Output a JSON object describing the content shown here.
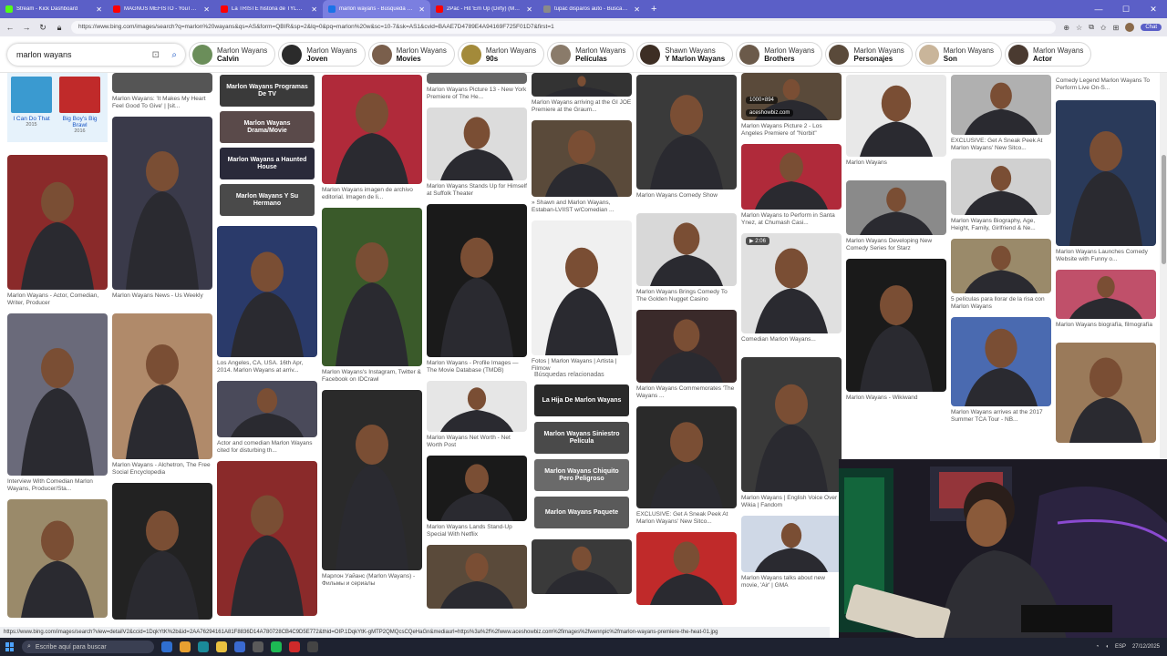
{
  "browser": {
    "tabs": [
      {
        "label": "Stream - Kick Dashboard",
        "color": "#53fc18"
      },
      {
        "label": "MAGNUS MEFISTO - YouTube",
        "color": "#ff0000"
      },
      {
        "label": "La TRISTE historia de TYLOR CHA",
        "color": "#ff0000"
      },
      {
        "label": "marlon wayans - Búsqueda Imáge",
        "color": "#1a73e8",
        "active": true
      },
      {
        "label": "2Pac - Hit 'Em Up (Dirty) (Music V",
        "color": "#ff0000"
      },
      {
        "label": "tupac disparos auto - Buscar con",
        "color": "#8a8a8a"
      }
    ],
    "new_tab": "+",
    "url": "https://www.bing.com/images/search?q=marlon%20wayans&qs=AS&form=QBIR&sp=2&lq=0&pq=marlon%20w&sc=10-7&sk=AS1&cvid=BAAE7D4789E4A94169F725F01D7&first=1",
    "chat_label": "Chat"
  },
  "search": {
    "query": "marlon wayans",
    "chips": [
      {
        "top": "Marlon Wayans",
        "bold": "Calvin",
        "color": "#6b8e5a"
      },
      {
        "top": "Marlon Wayans",
        "bold": "Joven",
        "color": "#2b2b2b"
      },
      {
        "top": "Marlon Wayans",
        "bold": "Movies",
        "color": "#7a5f4c"
      },
      {
        "top": "Marlon Wayans",
        "bold": "90s",
        "color": "#a38a3a"
      },
      {
        "top": "Marlon Wayans",
        "bold": "Películas",
        "color": "#8a7b6a"
      },
      {
        "top": "Shawn Wayans",
        "bold": "Y Marlon Wayans",
        "color": "#3d2e24"
      },
      {
        "top": "Marlon Wayans",
        "bold": "Brothers",
        "color": "#6b5a4a"
      },
      {
        "top": "Marlon Wayans",
        "bold": "Personajes",
        "color": "#5a4a3a"
      },
      {
        "top": "Marlon Wayans",
        "bold": "Son",
        "color": "#c9b59a"
      },
      {
        "top": "Marlon Wayans",
        "bold": "Actor",
        "color": "#4a3a30"
      }
    ]
  },
  "results": {
    "col0": [
      {
        "cap": "",
        "h": 76,
        "color": "#e6f2fb",
        "kind": "tiles"
      },
      {
        "cap": "Marlon Wayans - Actor, Comedian, Writer, Producer",
        "h": 148,
        "color": "#8a2a2a"
      },
      {
        "cap": "Interview With Comedian Marlon Wayans, Producer/Sta...",
        "h": 178,
        "color": "#6a6a7a"
      },
      {
        "cap": "",
        "h": 130,
        "color": "#9a8a6a"
      }
    ],
    "col1": [
      {
        "cap": "Marlon Wayans: 'It Makes My Heart Feel Good To Give' | [sit...",
        "h": 22,
        "color": "#555555"
      },
      {
        "cap": "Marlon Wayans News - Us Weekly",
        "h": 190,
        "color": "#3a3a4a"
      },
      {
        "cap": "Marlon Wayans - Alchetron, The Free Social Encyclopedia",
        "h": 160,
        "color": "#b08a6a"
      },
      {
        "cap": "",
        "h": 150,
        "color": "#222222"
      }
    ],
    "col2": [
      {
        "cap": "",
        "h": 160,
        "color": "#444444",
        "kind": "related-stack"
      },
      {
        "cap": "Los Angeles, CA, USA. 16th Apr, 2014. Marlon Wayans at arriv...",
        "h": 144,
        "color": "#2a3a6a"
      },
      {
        "cap": "Actor and comedian Marlon Wayans cited for disturbing th...",
        "h": 62,
        "color": "#4a4a5a"
      },
      {
        "cap": "",
        "h": 170,
        "color": "#8a2a2a"
      }
    ],
    "col3": [
      {
        "cap": "Marlon Wayans imagen de archivo editorial. Imagen de li...",
        "h": 120,
        "color": "#b02a3a"
      },
      {
        "cap": "Marlon Wayans's Instagram, Twitter & Facebook on IDCrawl",
        "h": 174,
        "color": "#3a5a2a"
      },
      {
        "cap": "Марлон Уайанс (Marlon Wayans) - Фильмы и сериалы",
        "h": 198,
        "color": "#2a2a2a"
      }
    ],
    "col4": [
      {
        "cap": "Marlon Wayans Picture 13 - New York Premiere of The He...",
        "h": 12,
        "color": "#666666"
      },
      {
        "cap": "Marlon Wayans Stands Up for Himself at Suffolk Theater",
        "h": 80,
        "color": "#dcdcdc"
      },
      {
        "cap": "Marlon Wayans - Profile Images — The Movie Database (TMDB)",
        "h": 168,
        "color": "#1a1a1a"
      },
      {
        "cap": "Marlon Wayans Net Worth - Net Worth Post",
        "h": 56,
        "color": "#e6e6e6"
      },
      {
        "cap": "Marlon Wayans Lands Stand-Up Special With Netflix",
        "h": 72,
        "color": "#1a1a1a"
      },
      {
        "cap": "",
        "h": 70,
        "color": "#5a4a3a"
      }
    ],
    "col5": [
      {
        "cap": "Marlon Wayans arriving at the GI JOE Premiere at the Graum...",
        "h": 26,
        "color": "#333333"
      },
      {
        "cap": "» Shawn and Marlon Wayans, Estaban-LVIIST w/Comedian ...",
        "h": 84,
        "color": "#5a4a3a"
      },
      {
        "cap": "Fotos | Marlon Wayans | Artista | Filmow",
        "h": 148,
        "color": "#f0f0f0"
      },
      {
        "cap": "",
        "h": 60,
        "color": "#3a3a3a"
      }
    ],
    "related_title": "Búsquedas relacionadas",
    "related": [
      {
        "label": "La Hija De Marlon Wayans",
        "color": "#2a2a2a"
      },
      {
        "label": "Marlon Wayans Siniestro Película",
        "color": "#4a4a4a"
      },
      {
        "label": "Marlon Wayans Chiquito Pero Peligroso",
        "color": "#6a6a6a"
      },
      {
        "label": "Marlon Wayans Paquete",
        "color": "#5a5a5a"
      }
    ],
    "col2_related": [
      {
        "label": "Marlon Wayans Programas De TV",
        "color": "#3a3a3a"
      },
      {
        "label": "Marlon Wayans Drama/Movie",
        "color": "#5a4a4a"
      },
      {
        "label": "Marlon Wayans a Haunted House",
        "color": "#2a2a3a"
      },
      {
        "label": "Marlon Wayans Y Su Hermano",
        "color": "#4a4a4a"
      }
    ],
    "col6": [
      {
        "cap": "Marlon Wayans Comedy Show",
        "h": 126,
        "color": "#3a3a3a"
      },
      {
        "cap": "Marlon Wayans Brings Comedy To The Golden Nugget Casino",
        "h": 80,
        "color": "#d8d8d8"
      },
      {
        "cap": "Marlon Wayans Commemorates 'The Wayans ...",
        "h": 80,
        "color": "#3a2a2a"
      },
      {
        "cap": "EXCLUSIVE: Get A Sneak Peek At Marlon Wayans' New Sitco...",
        "h": 112,
        "color": "#2a2a2a"
      },
      {
        "cap": "",
        "h": 80,
        "color": "#c02a2a"
      }
    ],
    "col7": [
      {
        "cap": "Marlon Wayans Picture 2 - Los Angeles Premiere of \"Norbit\"",
        "h": 52,
        "color": "#5a4a3a",
        "size": "1000×894",
        "src": "aceshowbiz.com"
      },
      {
        "cap": "Marlon Wayans to Perform in Santa Ynez, at Chumash Casi...",
        "h": 72,
        "color": "#b02a3a"
      },
      {
        "cap": "Comedian Marlon Wayans...",
        "h": 110,
        "color": "#e0e0e0",
        "badge": "▶ 2:06"
      },
      {
        "cap": "Marlon Wayans | English Voice Over Wikia | Fandom",
        "h": 148,
        "color": "#3a3a3a"
      },
      {
        "cap": "Marlon Wayans talks about new movie, 'Air' | GMA",
        "h": 62,
        "color": "#cfd8e6"
      }
    ],
    "col8": [
      {
        "cap": "Marlon Wayans",
        "h": 90,
        "color": "#e8e8e8"
      },
      {
        "cap": "Marlon Wayans Developing New Comedy Series for Starz",
        "h": 60,
        "color": "#8a8a8a"
      },
      {
        "cap": "Marlon Wayans - Wikiwand",
        "h": 146,
        "color": "#1a1a1a"
      }
    ],
    "col9": [
      {
        "cap": "EXCLUSIVE: Get A Sneak Peek At Marlon Wayans' New Sitco...",
        "h": 66,
        "color": "#b0b0b0"
      },
      {
        "cap": "Marlon Wayans Biography, Age, Height, Family, Girlfriend & Ne...",
        "h": 62,
        "color": "#d0d0d0"
      },
      {
        "cap": "5 películas para llorar de la risa con Marlon Wayans",
        "h": 60,
        "color": "#9a8a6a"
      },
      {
        "cap": "Marlon Wayans arrives at the 2017 Summer TCA Tour - NB...",
        "h": 98,
        "color": "#4a6ab0"
      }
    ],
    "col10": [
      {
        "cap": "Comedy Legend Marlon Wayans To Perform Live On-S...",
        "h": 0,
        "color": "#ffffff"
      },
      {
        "cap": "Marlon Wayans Launches Comedy Website with Funny o...",
        "h": 160,
        "color": "#2a3a5a"
      },
      {
        "cap": "Marlon Wayans biografía, filmografía",
        "h": 54,
        "color": "#c0506a"
      },
      {
        "cap": "",
        "h": 110,
        "color": "#9a7a5a"
      }
    ],
    "tiles": [
      {
        "title": "I Can Do That",
        "year": "2015"
      },
      {
        "title": "Big Boy's Big Brawl",
        "year": "2016"
      }
    ]
  },
  "statusbar": "https://www.bing.com/images/search?view=detailV2&ccid=1DqkYtK%2b&id=2AA76294161A81F8836D14A780728CB4C9D5E772&thid=OIP.1DqkYtK-gMTP2QMQcsCQeHaGn&mediaurl=https%3a%2f%2fwww.aceshowbiz.com%2fimages%2fwennpic%2fmarlon-wayans-premiere-the-heat-01.jpg",
  "taskbar": {
    "search_placeholder": "Escribe aquí para buscar",
    "date": "27/12/2025"
  }
}
